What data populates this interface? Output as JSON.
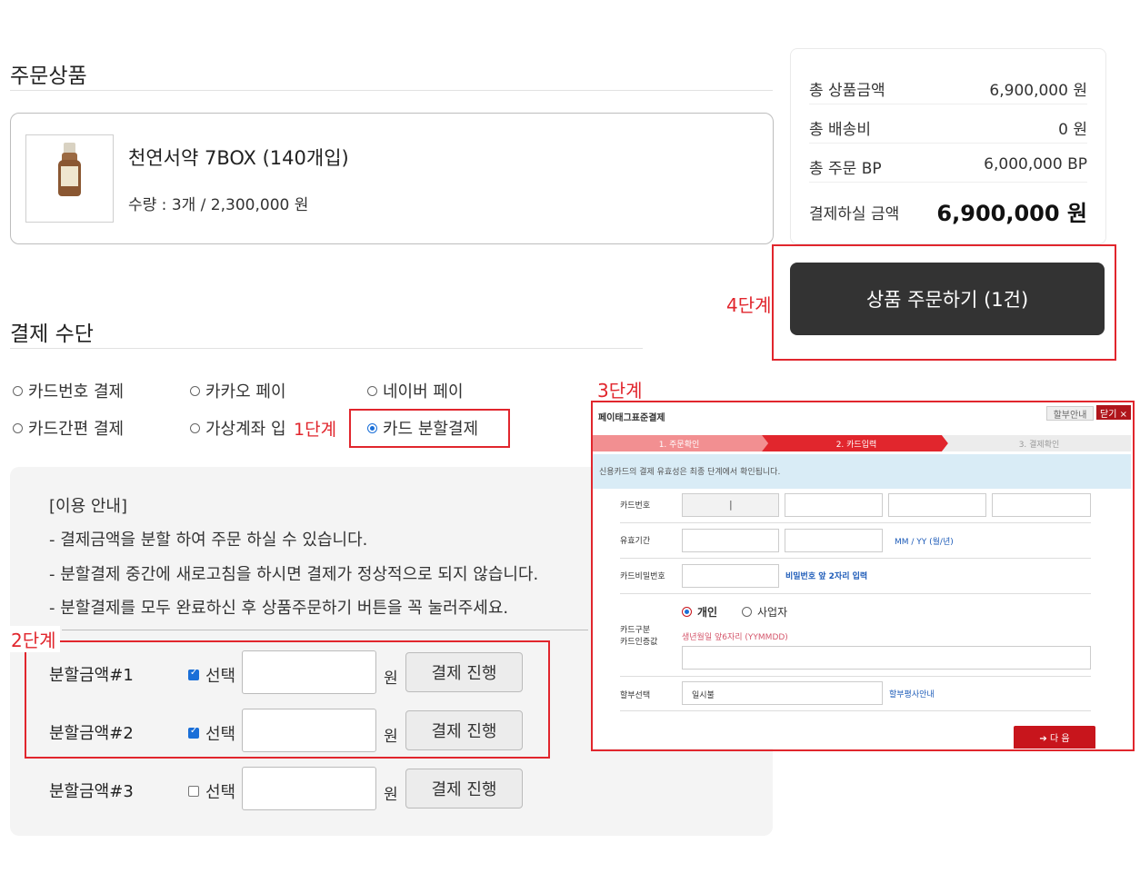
{
  "order_section": {
    "title": "주문상품",
    "product": {
      "name": "천연서약 7BOX (140개입)",
      "qty_price": "수량 : 3개 / 2,300,000 원"
    }
  },
  "summary": {
    "rows": [
      {
        "label": "총 상품금액",
        "value": "6,900,000 원"
      },
      {
        "label": "총 배송비",
        "value": "0 원"
      },
      {
        "label": "총 주문 BP",
        "value": "6,000,000 BP"
      }
    ],
    "total_label": "결제하실 금액",
    "total_value": "6,900,000 원",
    "order_button": "상품 주문하기 (1건)"
  },
  "steps": {
    "step1": "1단계",
    "step2": "2단계",
    "step3": "3단계",
    "step4": "4단계"
  },
  "payment": {
    "title": "결제 수단",
    "options": [
      {
        "label": "카드번호 결제",
        "selected": false
      },
      {
        "label": "카카오 페이",
        "selected": false
      },
      {
        "label": "네이버 페이",
        "selected": false
      },
      {
        "label": "카드간편 결제",
        "selected": false
      },
      {
        "label": "가상계좌 입",
        "selected": false
      },
      {
        "label": "카드 분할결제",
        "selected": true
      }
    ]
  },
  "guide": {
    "lines": [
      "[이용 안내]",
      "- 결제금액을 분할 하여 주문 하실 수 있습니다.",
      "- 분할결제 중간에 새로고침을 하시면 결제가 정상적으로 되지 않습니다.",
      "- 분할결제를 모두 완료하신 후 상품주문하기 버튼을 꼭 눌러주세요."
    ],
    "splits": [
      {
        "label": "분할금액#1",
        "checked": true,
        "check_text": "선택",
        "unit": "원",
        "button": "결제 진행"
      },
      {
        "label": "분할금액#2",
        "checked": true,
        "check_text": "선택",
        "unit": "원",
        "button": "결제 진행"
      },
      {
        "label": "분할금액#3",
        "checked": false,
        "check_text": "선택",
        "unit": "원",
        "button": "결제 진행"
      }
    ]
  },
  "popup": {
    "title": "페이태그표준결제",
    "help": "할부안내",
    "close": "닫기 ×",
    "steps": [
      "1. 주문확인",
      "2. 카드입력",
      "3. 결제확인"
    ],
    "info": "신용카드의 결제 유효성은 최종 단계에서 확인됩니다.",
    "card_number_label": "카드번호",
    "card_number_value": "|",
    "expiry_label": "유효기간",
    "expiry_hint": "MM / YY (월/년)",
    "pw_label": "카드비밀번호",
    "pw_hint": "비밀번호 앞 2자리 입력",
    "type_label": "카드구분",
    "auth_label": "카드인증값",
    "personal": "개인",
    "business": "사업자",
    "birth_hint": "생년월일 앞6자리 (YYMMDD)",
    "installment_label": "할부선택",
    "installment_value": "일시불",
    "installment_link": "할부평사안내",
    "next": "➔ 다 음"
  },
  "colors": {
    "accent_red": "#e1262d",
    "order_button_bg": "#333333",
    "popup_red": "#c8151c"
  }
}
